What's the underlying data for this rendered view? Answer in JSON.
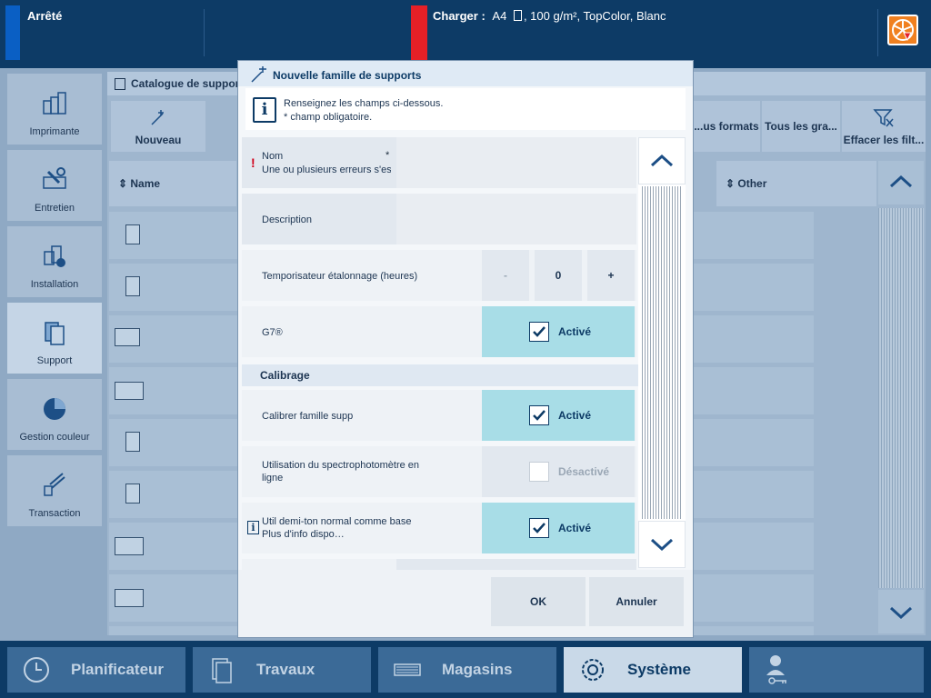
{
  "topbar": {
    "printer_state": "Arrêté",
    "load_label": "Charger :",
    "load_value": "A4",
    "load_details": ", 100 g/m², TopColor, Blanc",
    "status_color": "#0a5fc4",
    "alert_color": "#e52027"
  },
  "sidebar": {
    "items": [
      {
        "label": "Imprimante",
        "icon": "printer-icon"
      },
      {
        "label": "Entretien",
        "icon": "wrench-icon"
      },
      {
        "label": "Installation",
        "icon": "installation-icon"
      },
      {
        "label": "Support",
        "icon": "media-icon"
      },
      {
        "label": "Gestion couleur",
        "icon": "color-management-icon"
      },
      {
        "label": "Transaction",
        "icon": "transaction-icon"
      }
    ]
  },
  "catalog": {
    "title": "Catalogue de supports",
    "toolbar": {
      "new_label": "Nouveau",
      "all_formats": "...us formats",
      "all_weights": "Tous les gra...",
      "clear_filters": "Effacer les filt..."
    },
    "columns": {
      "name": "Name",
      "other": "Other"
    }
  },
  "dialog": {
    "title": "Nouvelle famille de supports",
    "info_line1": "Renseignez les champs ci-dessous.",
    "info_line2": "* champ obligatoire.",
    "fields": {
      "name_label": "Nom",
      "name_error": "Une ou plusieurs erreurs s'est",
      "required_mark": "*",
      "description_label": "Description",
      "timer_label": "Temporisateur étalonnage (heures)",
      "timer_minus": "-",
      "timer_value": "0",
      "timer_plus": "+",
      "g7_label": "G7®",
      "g7_state": "Activé",
      "calibration_section": "Calibrage",
      "calibrate_label": "Calibrer famille supp",
      "calibrate_state": "Activé",
      "spectro_label_1": "Utilisation du spectrophotomètre en",
      "spectro_label_2": "ligne",
      "spectro_state": "Désactivé",
      "halftone_label_1": "Util demi-ton normal comme base",
      "halftone_label_2": "Plus d'info dispo…",
      "halftone_state": "Activé"
    },
    "ok_label": "OK",
    "cancel_label": "Annuler"
  },
  "bottomnav": {
    "items": [
      {
        "label": "Planificateur",
        "icon": "clock-icon"
      },
      {
        "label": "Travaux",
        "icon": "jobs-icon"
      },
      {
        "label": "Magasins",
        "icon": "trays-icon"
      },
      {
        "label": "Système",
        "icon": "gear-icon"
      }
    ],
    "user_icon": "user-key-icon"
  }
}
